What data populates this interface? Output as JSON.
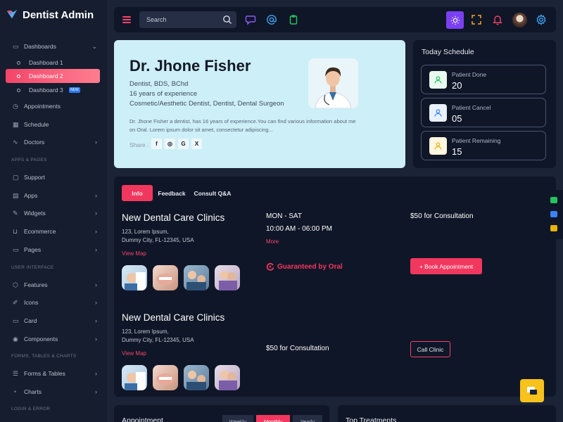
{
  "app": {
    "title": "Dentist Admin"
  },
  "sidebar": {
    "dashboards": "Dashboards",
    "sub": [
      "Dashboard 1",
      "Dashboard 2",
      "Dashboard 3"
    ],
    "new_badge": "NEW",
    "items_a": [
      "Appointments",
      "Schedule",
      "Doctors"
    ],
    "section_apps": "APPS & PAGES",
    "items_b": [
      "Support",
      "Apps",
      "Widgets",
      "Ecommerce",
      "Pages"
    ],
    "section_ui": "USER INTERFACE",
    "items_c": [
      "Features",
      "Icons",
      "Card",
      "Components"
    ],
    "section_forms": "FORMS, TABLES & CHARTS",
    "items_d": [
      "Forms & Tables",
      "Charts"
    ],
    "section_login": "LOGIN & ERROR"
  },
  "search": {
    "placeholder": "Search"
  },
  "profile": {
    "name": "Dr. Jhone Fisher",
    "degree": "Dentist, BDS, BChd",
    "experience": "16 years of experience",
    "specialties": "Cosmetic/Aesthetic Dentist, Dentist, Dental Surgeon",
    "description": "Dr. Jhone Fisher a dentist, has 16 years of experience.You can find various information about me on Oral. Lorem ipsum dolor sit amet, consectetur adipiscing...",
    "share_label": "Share :",
    "social": [
      "f",
      "◎",
      "G",
      "X"
    ]
  },
  "schedule": {
    "title": "Today Schedule",
    "items": [
      {
        "label": "Patient Done",
        "value": "20",
        "color": "#22c55e"
      },
      {
        "label": "Patient Cancel",
        "value": "05",
        "color": "#3b82f6"
      },
      {
        "label": "Patient Remaining",
        "value": "15",
        "color": "#eab308"
      }
    ]
  },
  "tabs": [
    "Info",
    "Feedback",
    "Consult Q&A"
  ],
  "clinics": [
    {
      "title": "New Dental Care Clinics",
      "address1": "123, Lorem Ipsum,",
      "address2": "Dummy City, FL-12345, USA",
      "view_map": "View Map",
      "days": "MON - SAT",
      "hours": "10:00 AM - 06:00 PM",
      "more": "More",
      "fee": "$50 for Consultation",
      "guarantee": "Guaranteed by Oral",
      "button": "+ Book Appointment"
    },
    {
      "title": "New Dental Care Clinics",
      "address1": "123, Lorem Ipsum,",
      "address2": "Dummy City, FL-12345, USA",
      "view_map": "View Map",
      "fee": "$50 for Consultation",
      "button": "Call Clinic"
    }
  ],
  "appointment": {
    "title": "Appointment",
    "periods": [
      "Weekly",
      "Monthly",
      "Yearly"
    ]
  },
  "treatments": {
    "title": "Top Treatments"
  },
  "colors": {
    "accent": "#f2375e",
    "sidebar": "#151d2e",
    "panel": "#0f1627",
    "profile_bg": "#cdeff7"
  }
}
